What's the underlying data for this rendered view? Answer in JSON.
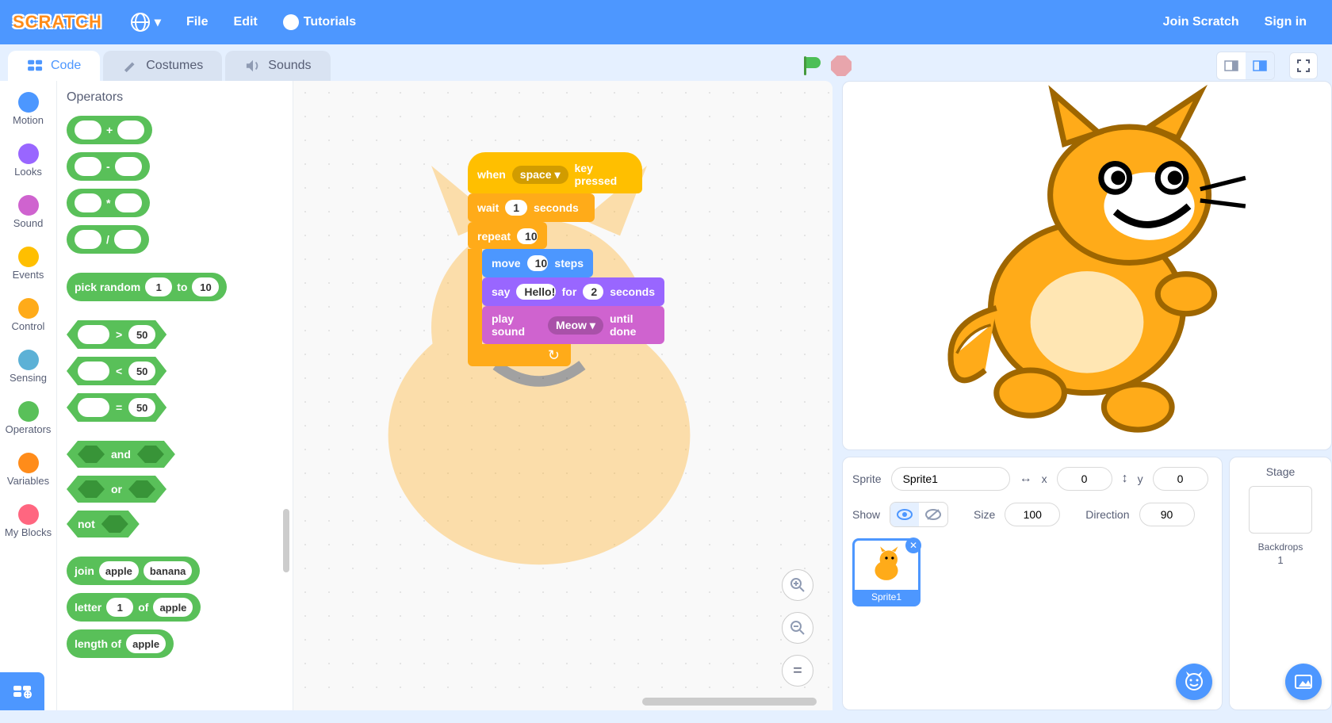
{
  "colors": {
    "brand": "#4d97ff",
    "motion": "#4c97ff",
    "looks": "#9966ff",
    "sound": "#cf63cf",
    "events": "#ffbf00",
    "control": "#ffab19",
    "sensing": "#5cb1d6",
    "operators": "#59c059",
    "variables": "#ff8c1a",
    "myblocks": "#ff6680"
  },
  "nav": {
    "logo": "SCRATCH",
    "file": "File",
    "edit": "Edit",
    "tutorials": "Tutorials",
    "join": "Join Scratch",
    "signin": "Sign in"
  },
  "tabs": {
    "code": "Code",
    "costumes": "Costumes",
    "sounds": "Sounds",
    "active": "code"
  },
  "categories": [
    {
      "name": "Motion",
      "color": "#4c97ff"
    },
    {
      "name": "Looks",
      "color": "#9966ff"
    },
    {
      "name": "Sound",
      "color": "#cf63cf"
    },
    {
      "name": "Events",
      "color": "#ffbf00"
    },
    {
      "name": "Control",
      "color": "#ffab19"
    },
    {
      "name": "Sensing",
      "color": "#5cb1d6"
    },
    {
      "name": "Operators",
      "color": "#59c059"
    },
    {
      "name": "Variables",
      "color": "#ff8c1a"
    },
    {
      "name": "My Blocks",
      "color": "#ff6680"
    }
  ],
  "selected_category": "Operators",
  "palette": {
    "heading": "Operators",
    "arith": [
      "+",
      "-",
      "*",
      "/"
    ],
    "pick_random": {
      "label1": "pick random",
      "v1": "1",
      "to": "to",
      "v2": "10"
    },
    "compare": [
      {
        "op": ">",
        "v": "50"
      },
      {
        "op": "<",
        "v": "50"
      },
      {
        "op": "=",
        "v": "50"
      }
    ],
    "bool": {
      "and": "and",
      "or": "or",
      "not": "not"
    },
    "join": {
      "label": "join",
      "a": "apple",
      "b": "banana"
    },
    "letter": {
      "label1": "letter",
      "n": "1",
      "of": "of",
      "s": "apple"
    },
    "length": {
      "label": "length of",
      "s": "apple"
    }
  },
  "script": {
    "hat": {
      "pre": "when",
      "key": "space",
      "post": "key pressed"
    },
    "wait": {
      "pre": "wait",
      "v": "1",
      "post": "seconds"
    },
    "repeat": {
      "pre": "repeat",
      "v": "10"
    },
    "move": {
      "pre": "move",
      "v": "10",
      "post": "steps"
    },
    "say": {
      "pre": "say",
      "msg": "Hello!",
      "for": "for",
      "sec": "2",
      "post": "seconds"
    },
    "play": {
      "pre": "play sound",
      "snd": "Meow",
      "post": "until done"
    }
  },
  "sprite_info": {
    "sprite_label": "Sprite",
    "name": "Sprite1",
    "x_label": "x",
    "x": "0",
    "y_label": "y",
    "y": "0",
    "show_label": "Show",
    "size_label": "Size",
    "size": "100",
    "direction_label": "Direction",
    "direction": "90"
  },
  "sprites": [
    {
      "name": "Sprite1"
    }
  ],
  "stage_panel": {
    "title": "Stage",
    "backdrops_label": "Backdrops",
    "backdrops_count": "1"
  }
}
